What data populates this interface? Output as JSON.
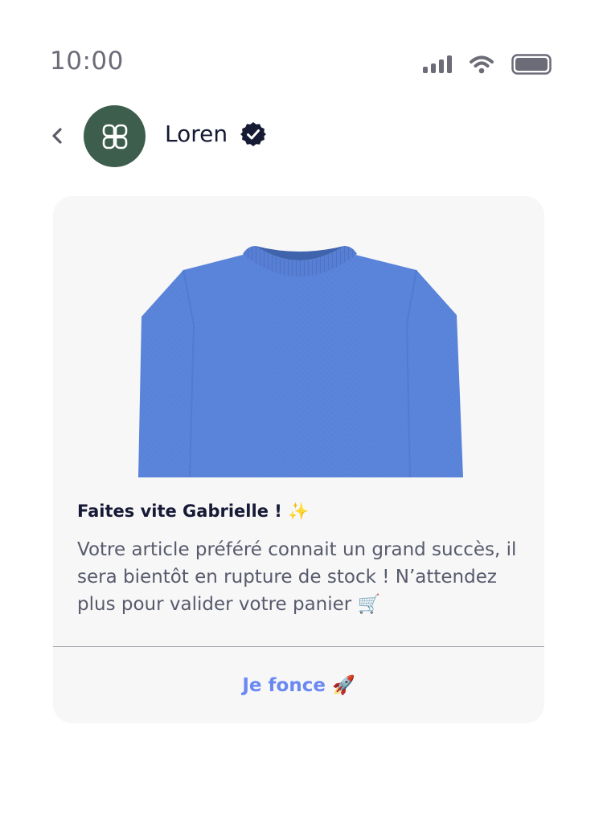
{
  "status_bar": {
    "time": "10:00",
    "icons": [
      "signal-icon",
      "wifi-icon",
      "battery-icon"
    ]
  },
  "header": {
    "back_icon": "chevron-left-icon",
    "avatar_icon": "four-petal-logo-icon",
    "sender_name": "Loren",
    "verified_icon": "verified-badge-icon"
  },
  "message_card": {
    "image": "blue-knit-sweater",
    "title": "Faites vite Gabrielle ! ✨",
    "body": "Votre article préféré connait un grand succès, il sera bientôt en rupture de stock ! N’attendez plus pour valider votre panier 🛒",
    "cta_label": "Je fonce 🚀"
  },
  "colors": {
    "avatar_bg": "#3d5e4c",
    "card_bg": "#f7f7f8",
    "cta_text": "#6a88f2",
    "sweater": "#5b86dd",
    "title_text": "#171a35"
  }
}
